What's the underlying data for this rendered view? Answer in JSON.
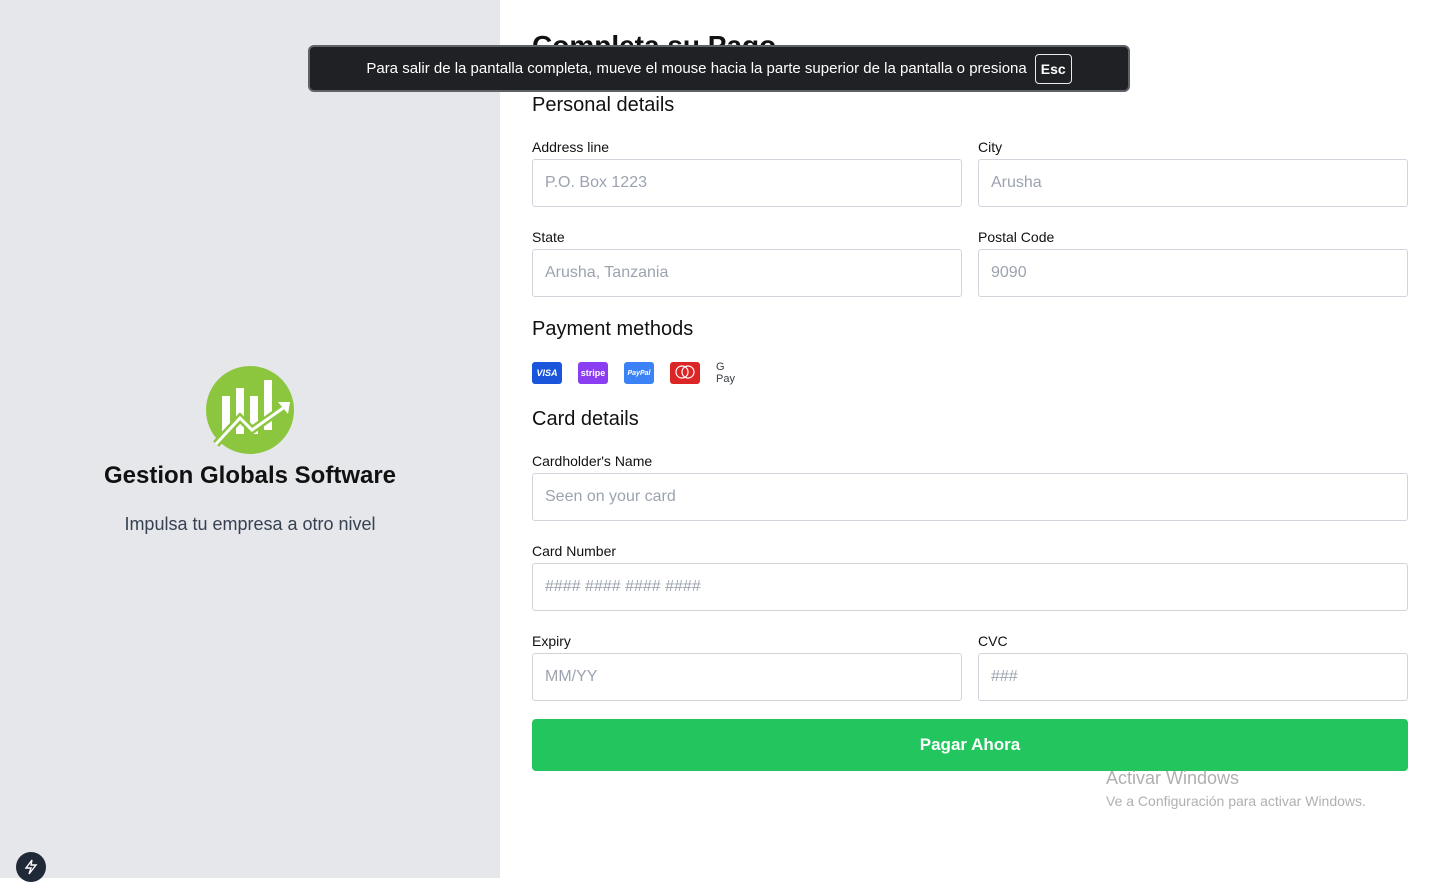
{
  "brand": {
    "name": "Gestion Globals Software",
    "tagline": "Impulsa tu empresa a otro nivel"
  },
  "form": {
    "heading": "Completa su Pago",
    "personal_title": "Personal details",
    "address": {
      "label": "Address line",
      "placeholder": "P.O. Box 1223"
    },
    "city": {
      "label": "City",
      "placeholder": "Arusha"
    },
    "state": {
      "label": "State",
      "placeholder": "Arusha, Tanzania"
    },
    "postal": {
      "label": "Postal Code",
      "placeholder": "9090"
    },
    "payment_title": "Payment methods",
    "payment_methods": [
      {
        "name": "visa-icon",
        "label": "VISA",
        "color": "#1a56db"
      },
      {
        "name": "stripe-icon",
        "label": "stripe",
        "color": "#8b3df1"
      },
      {
        "name": "paypal-icon",
        "label": "PayPal",
        "color": "#3b82f6"
      },
      {
        "name": "mastercard-icon",
        "label": "mastercard",
        "color": "#dc2626"
      },
      {
        "name": "gpay-icon",
        "label": "G Pay",
        "color": "#ffffff"
      }
    ],
    "card_title": "Card details",
    "cardholder": {
      "label": "Cardholder's Name",
      "placeholder": "Seen on your card"
    },
    "card_number": {
      "label": "Card Number",
      "placeholder": "#### #### #### ####"
    },
    "expiry": {
      "label": "Expiry",
      "placeholder": "MM/YY"
    },
    "cvc": {
      "label": "CVC",
      "placeholder": "###"
    },
    "submit_label": "Pagar Ahora"
  },
  "fullscreen_banner": {
    "text": "Para salir de la pantalla completa, mueve el mouse hacia la parte superior de la pantalla o presiona",
    "key": "Esc"
  },
  "watermark": {
    "title": "Activar Windows",
    "subtitle": "Ve a Configuración para activar Windows."
  },
  "colors": {
    "accent": "#22c55e",
    "left_bg": "#e5e7eb",
    "logo_green": "#8cc63f"
  }
}
